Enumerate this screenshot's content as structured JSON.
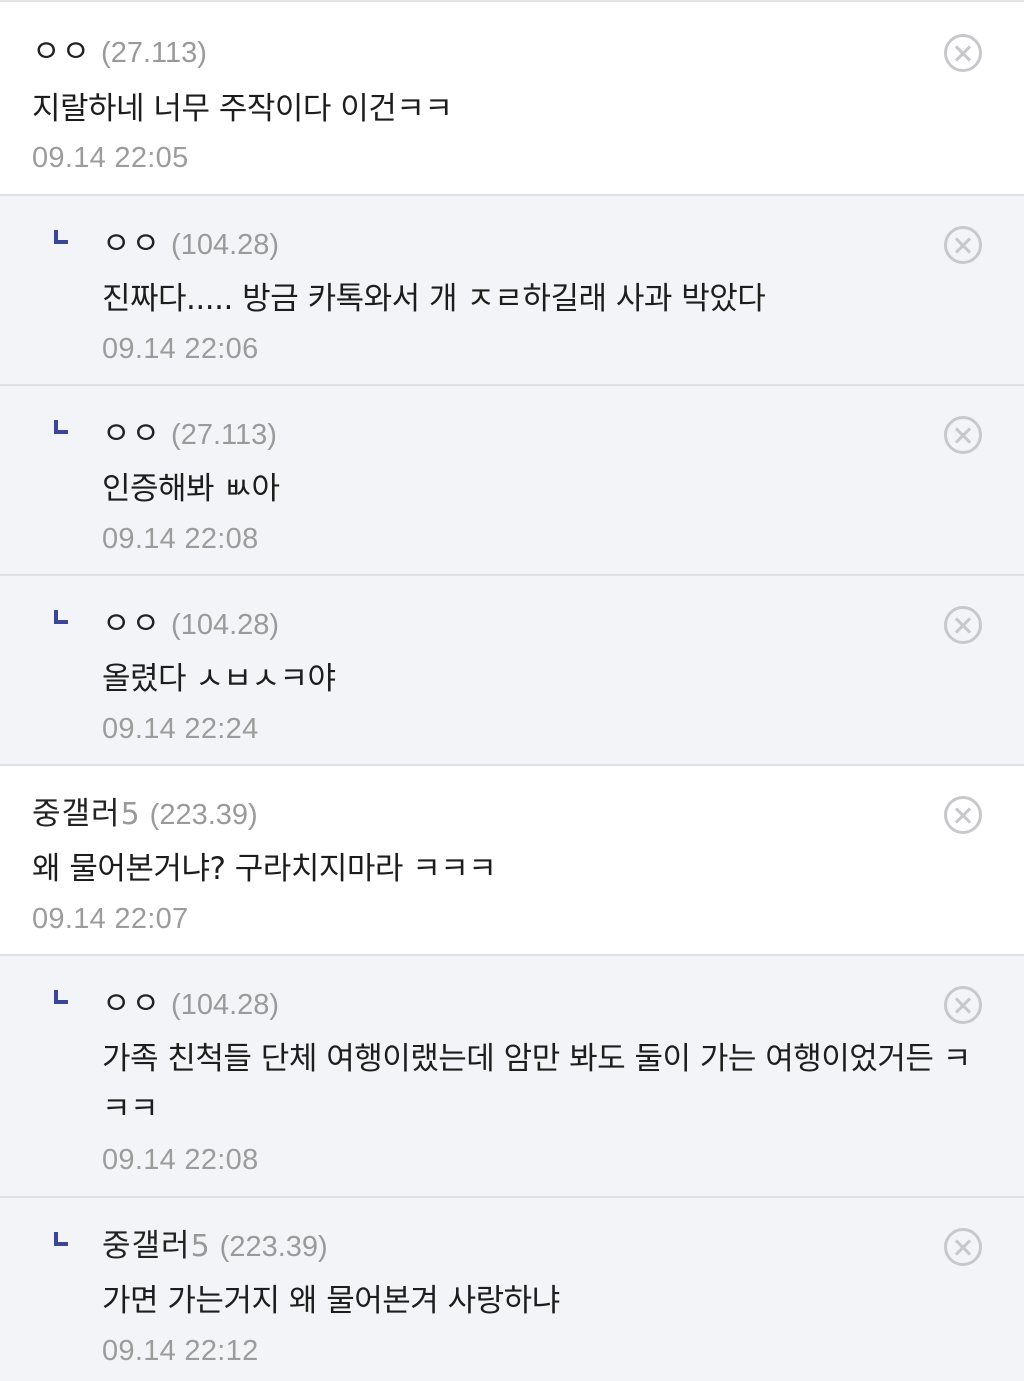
{
  "comments": [
    {
      "type": "root",
      "nick": "ㅇㅇ",
      "level": "",
      "ip": "(27.113)",
      "text": "지랄하네 너무 주작이다 이건ㅋㅋ",
      "date": "09.14 22:05"
    },
    {
      "type": "reply",
      "nick": "ㅇㅇ",
      "level": "",
      "ip": "(104.28)",
      "text": "진짜다..... 방금 카톡와서 개 ㅈㄹ하길래 사과 박았다",
      "date": "09.14 22:06"
    },
    {
      "type": "reply",
      "nick": "ㅇㅇ",
      "level": "",
      "ip": "(27.113)",
      "text": "인증해봐 ㅄ아",
      "date": "09.14 22:08"
    },
    {
      "type": "reply",
      "nick": "ㅇㅇ",
      "level": "",
      "ip": "(104.28)",
      "text": "올렸다 ㅅㅂㅅㅋ야",
      "date": "09.14 22:24"
    },
    {
      "type": "root",
      "nick": "중갤러",
      "level": "5",
      "ip": "(223.39)",
      "text": "왜 물어본거냐? 구라치지마라 ㅋㅋㅋ",
      "date": "09.14 22:07"
    },
    {
      "type": "reply",
      "nick": "ㅇㅇ",
      "level": "",
      "ip": "(104.28)",
      "text": "가족 친척들 단체 여행이랬는데 암만 봐도 둘이 가는 여행이었거든 ㅋㅋㅋ",
      "date": "09.14 22:08"
    },
    {
      "type": "reply",
      "nick": "중갤러",
      "level": "5",
      "ip": "(223.39)",
      "text": "가면 가는거지 왜 물어본겨 사랑하냐",
      "date": "09.14 22:12"
    }
  ]
}
